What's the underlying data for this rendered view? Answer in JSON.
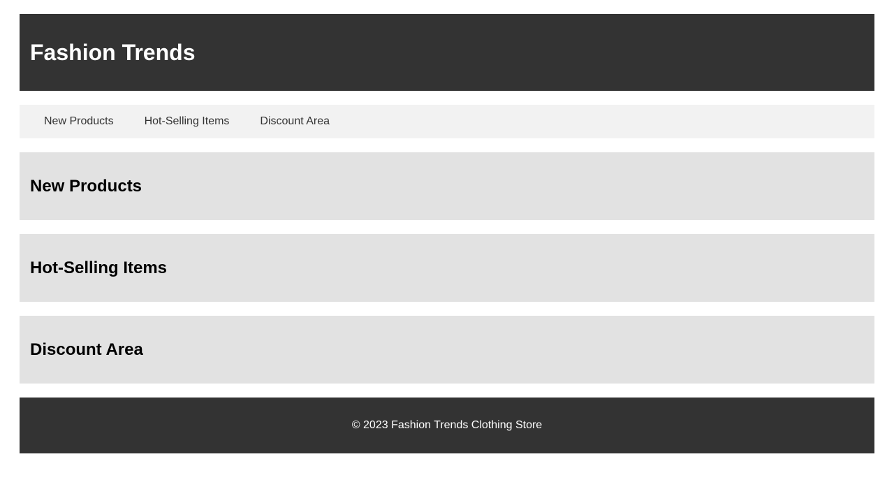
{
  "header": {
    "title": "Fashion Trends"
  },
  "nav": {
    "items": [
      {
        "label": "New Products"
      },
      {
        "label": "Hot-Selling Items"
      },
      {
        "label": "Discount Area"
      }
    ]
  },
  "sections": [
    {
      "title": "New Products"
    },
    {
      "title": "Hot-Selling Items"
    },
    {
      "title": "Discount Area"
    }
  ],
  "footer": {
    "text": "© 2023 Fashion Trends Clothing Store"
  },
  "colors": {
    "header_bg": "#333333",
    "nav_bg": "#f2f2f2",
    "section_bg": "#e2e2e2",
    "footer_bg": "#333333"
  }
}
